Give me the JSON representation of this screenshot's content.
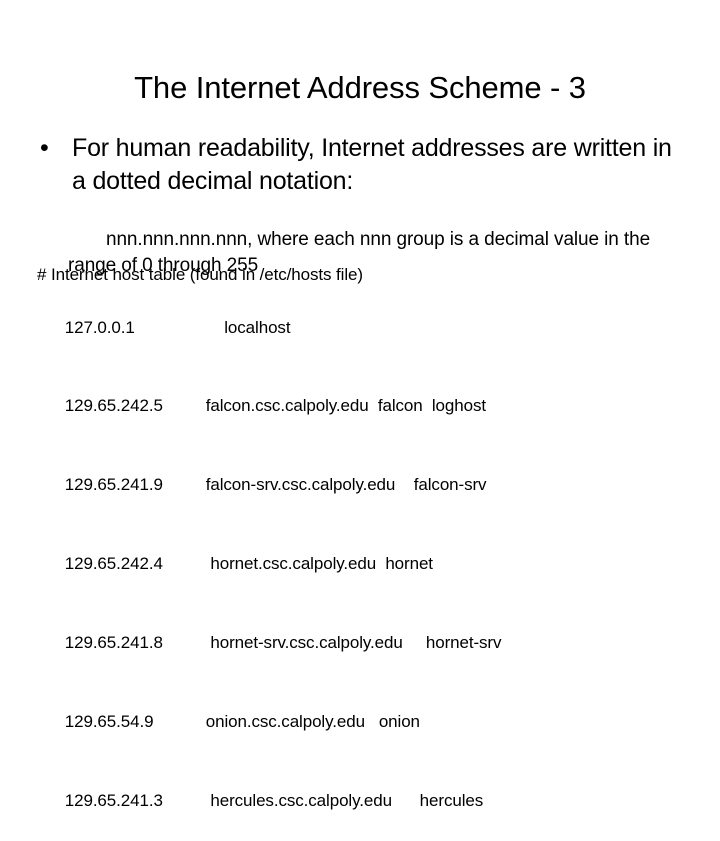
{
  "slide": {
    "title": "The Internet Address Scheme - 3",
    "bullets": [
      {
        "marker": "•",
        "text": "For human readability, Internet addresses are written in a dotted decimal notation:"
      }
    ],
    "sub_paragraph": "nnn.nnn.nnn.nnn, where each nnn group is a decimal value in the range of 0 through 255",
    "host_table": {
      "comment": "# Internet host table (found in /etc/hosts file)",
      "rows": [
        {
          "ip": "127.0.0.1",
          "hostname": "localhost",
          "aliases": "",
          "name_pad": "    ",
          "alias_pad": ""
        },
        {
          "ip": "129.65.242.5",
          "hostname": "falcon.csc.calpoly.edu",
          "aliases": "falcon  loghost",
          "name_pad": "",
          "alias_pad": "  "
        },
        {
          "ip": "129.65.241.9",
          "hostname": "falcon-srv.csc.calpoly.edu",
          "aliases": "falcon-srv",
          "name_pad": "",
          "alias_pad": "    "
        },
        {
          "ip": "129.65.242.4",
          "hostname": "hornet.csc.calpoly.edu",
          "aliases": "hornet",
          "name_pad": " ",
          "alias_pad": "  "
        },
        {
          "ip": "129.65.241.8",
          "hostname": "hornet-srv.csc.calpoly.edu",
          "aliases": "hornet-srv",
          "name_pad": " ",
          "alias_pad": "     "
        },
        {
          "ip": "129.65.54.9",
          "hostname": "onion.csc.calpoly.edu",
          "aliases": "onion",
          "name_pad": "",
          "alias_pad": "   "
        },
        {
          "ip": "129.65.241.3",
          "hostname": "hercules.csc.calpoly.edu",
          "aliases": "hercules",
          "name_pad": " ",
          "alias_pad": "      "
        }
      ]
    }
  },
  "theme": {
    "background": "#ffffff",
    "text_color": "#000000"
  }
}
